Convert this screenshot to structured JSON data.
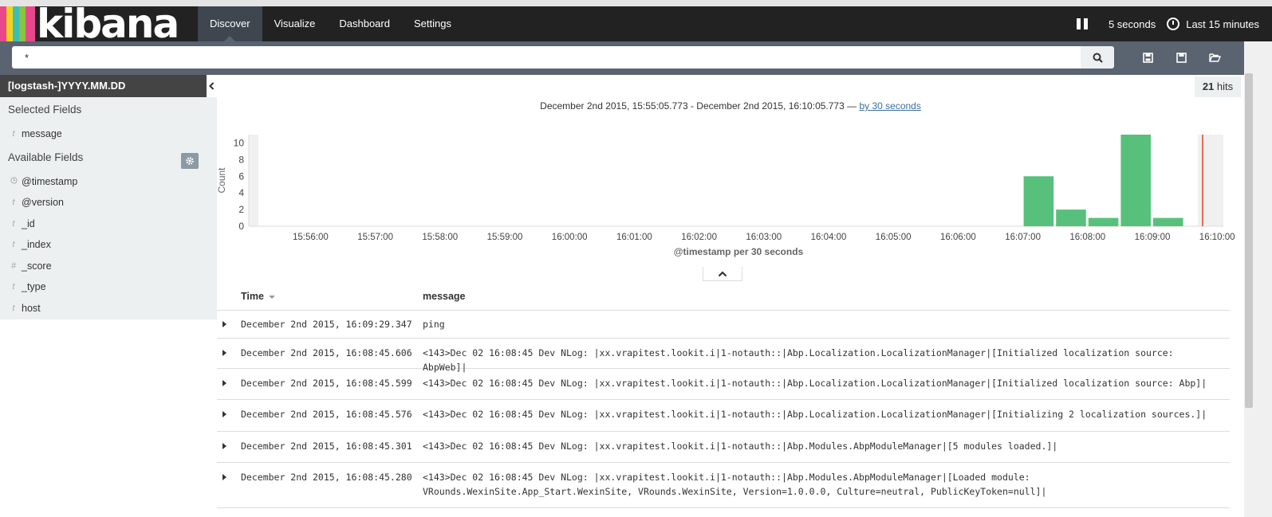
{
  "app": {
    "logo_text": "kibana"
  },
  "nav": {
    "tabs": [
      {
        "label": "Discover",
        "active": true
      },
      {
        "label": "Visualize",
        "active": false
      },
      {
        "label": "Dashboard",
        "active": false
      },
      {
        "label": "Settings",
        "active": false
      }
    ],
    "refresh_label": "5 seconds",
    "time_label": "Last 15 minutes"
  },
  "search": {
    "query": "*"
  },
  "sidebar": {
    "index_pattern": "[logstash-]YYYY.MM.DD",
    "selected_heading": "Selected Fields",
    "available_heading": "Available Fields",
    "selected_fields": [
      {
        "type": "t",
        "name": "message"
      }
    ],
    "available_fields": [
      {
        "type": "clock",
        "name": "@timestamp"
      },
      {
        "type": "t",
        "name": "@version"
      },
      {
        "type": "t",
        "name": "_id"
      },
      {
        "type": "t",
        "name": "_index"
      },
      {
        "type": "#",
        "name": "_score"
      },
      {
        "type": "t",
        "name": "_type"
      },
      {
        "type": "t",
        "name": "host"
      }
    ]
  },
  "results": {
    "hits_count": "21",
    "hits_label": "hits",
    "time_range": "December 2nd 2015, 15:55:05.773 - December 2nd 2015, 16:10:05.773 —",
    "interval_link": "by 30 seconds"
  },
  "chart_data": {
    "type": "bar",
    "xlabel": "@timestamp per 30 seconds",
    "ylabel": "Count",
    "ylim": [
      0,
      11
    ],
    "yticks": [
      0,
      2,
      4,
      6,
      8,
      10
    ],
    "tick_labels": [
      "15:56:00",
      "15:57:00",
      "15:58:00",
      "15:59:00",
      "16:00:00",
      "16:01:00",
      "16:02:00",
      "16:03:00",
      "16:04:00",
      "16:05:00",
      "16:06:00",
      "16:07:00",
      "16:08:00",
      "16:09:00",
      "16:10:00"
    ],
    "bars": [
      {
        "x": "16:07:00",
        "value": 6
      },
      {
        "x": "16:07:30",
        "value": 2
      },
      {
        "x": "16:08:00",
        "value": 1
      },
      {
        "x": "16:08:30",
        "value": 11
      },
      {
        "x": "16:09:00",
        "value": 1
      }
    ],
    "bar_color": "#57c17b",
    "now_marker_color": "#e66d52"
  },
  "table": {
    "col_time": "Time",
    "col_message": "message",
    "rows": [
      {
        "time": "December 2nd 2015, 16:09:29.347",
        "message": "ping"
      },
      {
        "time": "December 2nd 2015, 16:08:45.606",
        "message": "<143>Dec 02 16:08:45 Dev NLog: |xx.vrapitest.lookit.i|1-notauth::|Abp.Localization.LocalizationManager|[Initialized localization source: AbpWeb]|"
      },
      {
        "time": "December 2nd 2015, 16:08:45.599",
        "message": "<143>Dec 02 16:08:45 Dev NLog: |xx.vrapitest.lookit.i|1-notauth::|Abp.Localization.LocalizationManager|[Initialized localization source: Abp]|"
      },
      {
        "time": "December 2nd 2015, 16:08:45.576",
        "message": "<143>Dec 02 16:08:45 Dev NLog: |xx.vrapitest.lookit.i|1-notauth::|Abp.Localization.LocalizationManager|[Initializing 2 localization sources.]|"
      },
      {
        "time": "December 2nd 2015, 16:08:45.301",
        "message": "<143>Dec 02 16:08:45 Dev NLog: |xx.vrapitest.lookit.i|1-notauth::|Abp.Modules.AbpModuleManager|[5 modules loaded.]|"
      },
      {
        "time": "December 2nd 2015, 16:08:45.280",
        "message": "<143>Dec 02 16:08:45 Dev NLog: |xx.vrapitest.lookit.i|1-notauth::|Abp.Modules.AbpModuleManager|[Loaded module: VRounds.WexinSite.App_Start.WexinSite, VRounds.WexinSite, Version=1.0.0.0, Culture=neutral, PublicKeyToken=null]|"
      }
    ]
  }
}
